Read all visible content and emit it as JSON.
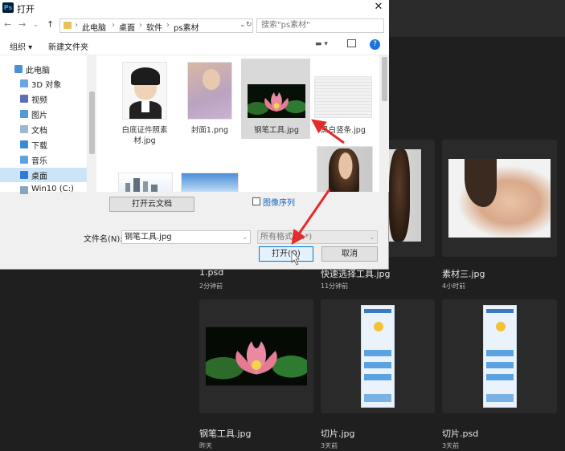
{
  "dialog": {
    "title": "打开",
    "breadcrumb": [
      "此电脑",
      "桌面",
      "软件",
      "ps素材"
    ],
    "search_placeholder": "搜索\"ps素材\"",
    "toolbar": {
      "organize": "组织 ▾",
      "new_folder": "新建文件夹"
    },
    "sidebar": [
      {
        "label": "此电脑",
        "icon": "computer-icon"
      },
      {
        "label": "3D 对象",
        "icon": "cube-icon"
      },
      {
        "label": "视频",
        "icon": "video-icon"
      },
      {
        "label": "图片",
        "icon": "picture-icon"
      },
      {
        "label": "文档",
        "icon": "document-icon"
      },
      {
        "label": "下载",
        "icon": "download-icon"
      },
      {
        "label": "音乐",
        "icon": "music-icon"
      },
      {
        "label": "桌面",
        "icon": "desktop-icon"
      },
      {
        "label": "Win10 (C:)",
        "icon": "drive-icon"
      }
    ],
    "files": [
      {
        "name": "白底证件照素材.jpg"
      },
      {
        "name": "封面1.png"
      },
      {
        "name": "钢笔工具.jpg"
      },
      {
        "name": "黑白竖条.jpg"
      }
    ],
    "cloud_button": "打开云文档",
    "image_sequence": "图像序列",
    "filename_label": "文件名(N):",
    "filename_value": "钢笔工具.jpg",
    "format_value": "所有格式 (*.*)",
    "open_button": "打开(O)",
    "cancel_button": "取消"
  },
  "photoshop": {
    "recent": [
      {
        "name": "1.psd",
        "time": "2分钟前"
      },
      {
        "name": "快速选择工具.jpg",
        "time": "11分钟前"
      },
      {
        "name": "素材三.jpg",
        "time": "4小时前"
      },
      {
        "name": "钢笔工具.jpg",
        "time": "昨天"
      },
      {
        "name": "切片.jpg",
        "time": "3天前"
      },
      {
        "name": "切片.psd",
        "time": "3天前"
      }
    ]
  }
}
